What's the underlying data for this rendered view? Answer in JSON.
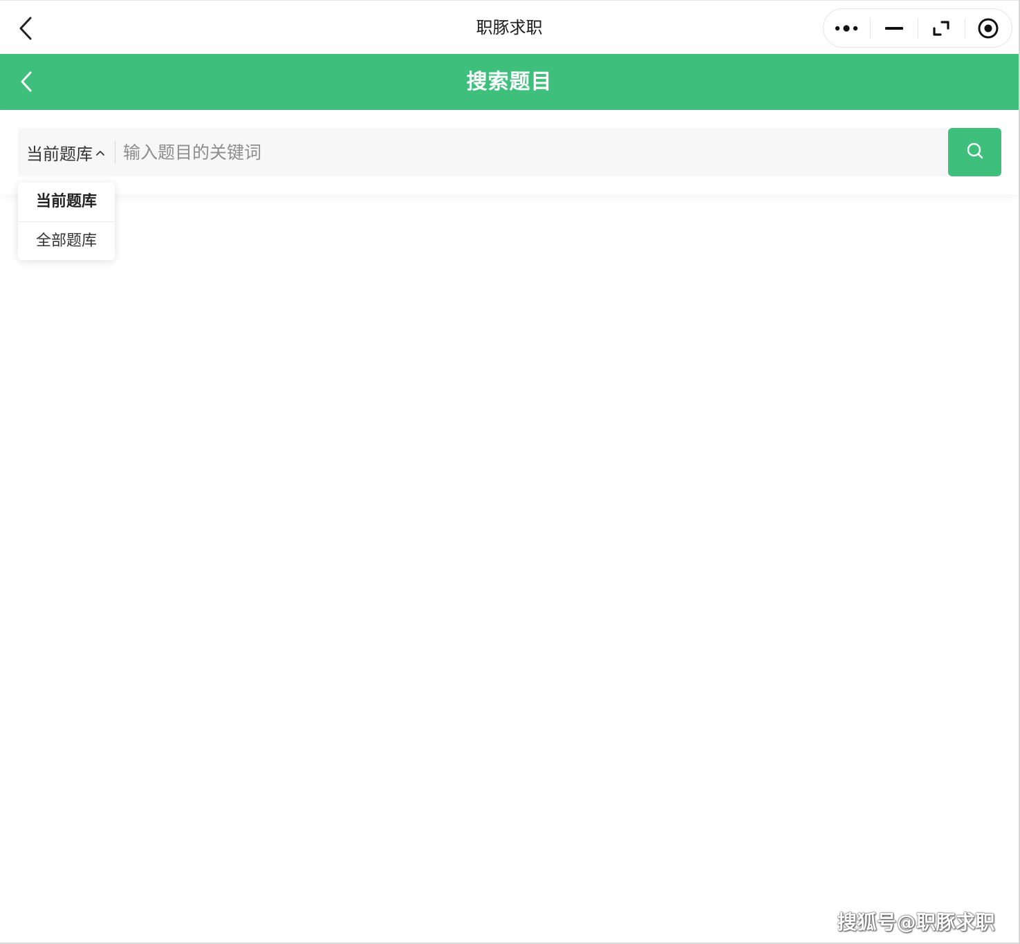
{
  "mini_program": {
    "title": "职豚求职",
    "capsule": [
      "more-dots-icon",
      "minimize-icon",
      "restore-icon",
      "close-target-icon"
    ]
  },
  "header": {
    "title": "搜索题目",
    "color": "#3ebf7c"
  },
  "search": {
    "scope_label": "当前题库",
    "placeholder": "输入题目的关键词",
    "value": ""
  },
  "dropdown": {
    "items": [
      {
        "label": "当前题库",
        "selected": true
      },
      {
        "label": "全部题库",
        "selected": false
      }
    ]
  },
  "watermark": "搜狐号@职豚求职"
}
